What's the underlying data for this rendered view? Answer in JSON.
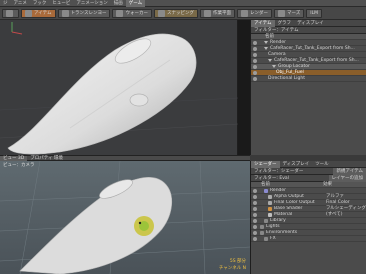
{
  "tabs": [
    "ジ",
    "アニメ",
    "フック",
    "ヒュービ",
    "アニメーション",
    "描画",
    "ゲーム"
  ],
  "tabs_active_index": 6,
  "toolbar": {
    "buttons": [
      {
        "label": "",
        "icon": "grid-icon",
        "tone": ""
      },
      {
        "label": "アイテム",
        "icon": "cube-icon",
        "tone": "hot"
      },
      {
        "label": "トランスレンヨー",
        "icon": "move-icon",
        "tone": ""
      },
      {
        "label": "ウォーカー",
        "icon": "arrow-icon",
        "tone": ""
      },
      {
        "label": "スナッピング",
        "icon": "magnet-icon",
        "tone": "warm"
      },
      {
        "label": "作業平面",
        "icon": "plane-icon",
        "tone": ""
      },
      {
        "label": "レンダー",
        "icon": "render-icon",
        "tone": ""
      },
      {
        "label": "マーズ",
        "icon": "preview-icon",
        "tone": ""
      },
      {
        "label": "ILM",
        "icon": "",
        "tone": ""
      }
    ]
  },
  "items_panel": {
    "tabs": [
      "アイテム",
      "グラフ",
      "ディスプレイ"
    ],
    "filter_label": "フィルター：アイテム",
    "columns": [
      "",
      "名前"
    ],
    "rows": [
      {
        "label": "Render",
        "indent": 1,
        "tri": true,
        "style": ""
      },
      {
        "label": "CafeRacer_Tut_Tank_Export from Sh...",
        "indent": 1,
        "tri": true,
        "style": ""
      },
      {
        "label": "Camera",
        "indent": 2,
        "tri": false,
        "style": ""
      },
      {
        "label": "CafeRacer_Tut_Tank_Export from Sh...",
        "indent": 2,
        "tri": true,
        "style": ""
      },
      {
        "label": "Group Locator",
        "indent": 3,
        "tri": true,
        "style": "sel"
      },
      {
        "label": "Obj_Ful_Fuel",
        "indent": 4,
        "tri": false,
        "style": "hl"
      },
      {
        "label": "Directional Light",
        "indent": 2,
        "tri": false,
        "style": ""
      }
    ]
  },
  "viewport_split": [
    "ビュー 3D",
    "プロパティ 環境"
  ],
  "viewport2_label": "ビュー：カメラ",
  "shader_panel": {
    "tabs": [
      "シェーダー",
      "ディスプレイ",
      "ツール"
    ],
    "filter_row": [
      "フィルター：シェーダー",
      "新規アイテム"
    ],
    "sub_row": [
      "フィルター: Eval",
      "レイヤーの追加"
    ],
    "headers": [
      "名前",
      "効果"
    ],
    "rows": [
      {
        "name": "Render",
        "effect": "",
        "dot": "#8b8bd0",
        "indent": 1
      },
      {
        "name": "Alpha Output",
        "effect": "アルファ",
        "dot": "#aaaaaa",
        "indent": 2
      },
      {
        "name": "Final Color Output",
        "effect": "Final Color",
        "dot": "#aaaaaa",
        "indent": 2
      },
      {
        "name": "Base Shader",
        "effect": "フルシェーディング",
        "dot": "#d09040",
        "indent": 2
      },
      {
        "name": "Material",
        "effect": "(すべて)",
        "dot": "#c0c0c0",
        "indent": 2
      },
      {
        "name": "Library",
        "effect": "",
        "dot": "#888888",
        "indent": 1
      },
      {
        "name": "Lights",
        "effect": "",
        "dot": "#888888",
        "indent": 0
      },
      {
        "name": "Environments",
        "effect": "",
        "dot": "#888888",
        "indent": 0
      },
      {
        "name": "FX",
        "effect": "",
        "dot": "#888888",
        "indent": 1
      }
    ]
  },
  "viewport2_readouts": [
    "5S 部分",
    "チャンネル N"
  ]
}
